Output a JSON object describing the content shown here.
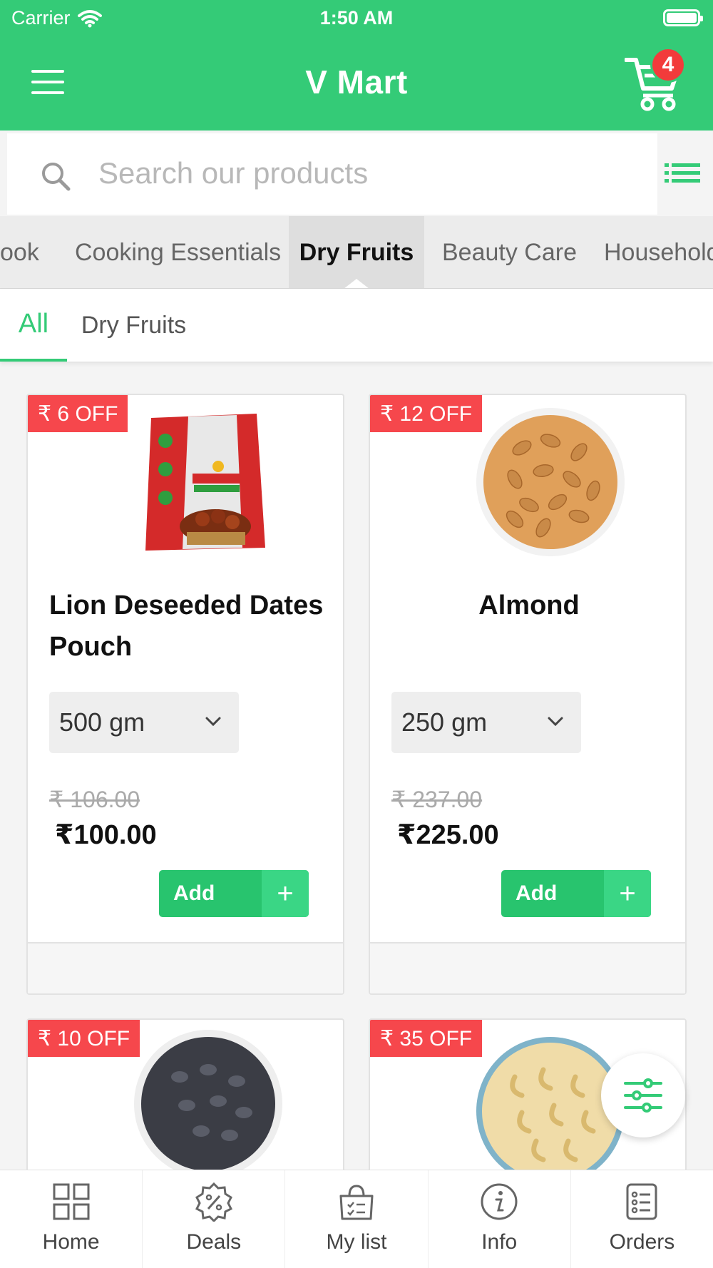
{
  "status_bar": {
    "carrier": "Carrier",
    "time": "1:50 AM"
  },
  "header": {
    "title": "V Mart",
    "cart_count": "4"
  },
  "search": {
    "placeholder": "Search our products"
  },
  "categories": [
    "ook",
    "Cooking Essentials",
    "Dry Fruits",
    "Beauty Care",
    "Household"
  ],
  "active_category": "Dry Fruits",
  "subcategories": [
    "All",
    "Dry Fruits"
  ],
  "active_subcategory": "All",
  "products": [
    {
      "discount": "₹ 6 OFF",
      "name": "Lion Deseeded Dates Pouch",
      "size": "500 gm",
      "old_price": "₹ 106.00",
      "price": "₹100.00",
      "add_label": "Add"
    },
    {
      "discount": "₹ 12 OFF",
      "name": "Almond",
      "size": "250 gm",
      "old_price": "₹ 237.00",
      "price": "₹225.00",
      "add_label": "Add"
    },
    {
      "discount": "₹ 10 OFF"
    },
    {
      "discount": "₹ 35 OFF"
    }
  ],
  "bottom_nav": [
    "Home",
    "Deals",
    "My list",
    "Info",
    "Orders"
  ],
  "colors": {
    "primary": "#34cb77",
    "badge": "#f6474c",
    "cart_badge": "#f23b3b"
  }
}
